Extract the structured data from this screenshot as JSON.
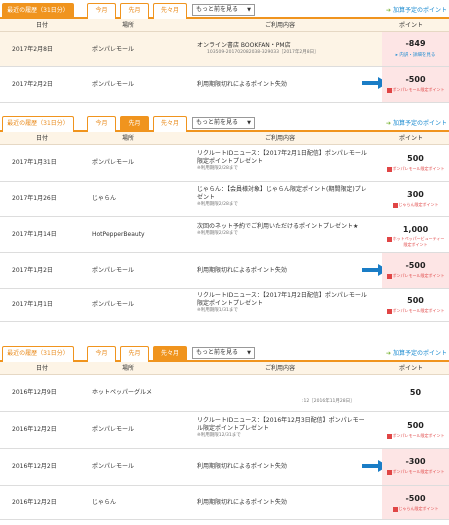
{
  "tabs": {
    "recent": "最近の履歴（31日分）",
    "this_month": "今月",
    "last_month": "先月",
    "two_months_ago": "先々月"
  },
  "select_value": "もっと前を見る",
  "pending_link": "加算予定のポイント",
  "headers": {
    "date": "日付",
    "place": "場所",
    "usage": "ご利用内容",
    "points": "ポイント"
  },
  "colors": {
    "accent": "#f0941e",
    "link": "#1a8ad0",
    "negative_bg": "#fde5e5",
    "arrow": "#1a7dc6"
  },
  "panel1": {
    "rows": [
      {
        "date": "2017年2月8日",
        "place": "ポンパレモール",
        "usage": "オンライン書店 BOOKFAN・PM店",
        "sub": "103509-201702082038-329033［2017年2月8日］",
        "points": "-849",
        "link": "内訳・詳細を見る"
      },
      {
        "date": "2017年2月2日",
        "place": "ポンパレモール",
        "usage": "利用期限切れによるポイント失効",
        "points": "-500",
        "plabel": "ポンパレモール限定ポイント"
      }
    ]
  },
  "panel2": {
    "rows": [
      {
        "date": "2017年1月31日",
        "place": "ポンパレモール",
        "usage": "リクルートIDニュース：【2017年2月1日配信】ポンパレモール限定ポイントプレゼント",
        "sub": "※利用期限2/28まで",
        "points": "500",
        "plabel": "ポンパレモール限定ポイント"
      },
      {
        "date": "2017年1月26日",
        "place": "じゃらん",
        "usage": "じゃらん：【会員様対象】じゃらん限定ポイント(期間限定)プレゼント",
        "sub": "※利用期限2/28まで",
        "points": "300",
        "plabel": "じゃらん限定ポイント"
      },
      {
        "date": "2017年1月14日",
        "place": "HotPepperBeauty",
        "usage": "次回のネット予約でご利用いただけるポイントプレゼント★",
        "sub": "※利用期限2/28まで",
        "points": "1,000",
        "plabel": "ホットペッパービューティー限定ポイント"
      },
      {
        "date": "2017年1月2日",
        "place": "ポンパレモール",
        "usage": "利用期限切れによるポイント失効",
        "points": "-500",
        "plabel": "ポンパレモール限定ポイント"
      },
      {
        "date": "2017年1月1日",
        "place": "ポンパレモール",
        "usage": "リクルートIDニュース：【2017年1月2日配信】ポンパレモール限定ポイントプレゼント",
        "sub": "※利用期限1/31まで",
        "points": "500",
        "plabel": "ポンパレモール限定ポイント"
      }
    ]
  },
  "panel3": {
    "rows": [
      {
        "date": "2016年12月9日",
        "place": "ホットペッパーグルメ",
        "usage": "",
        "sub": ":12［2016年11月28日］",
        "points": "50"
      },
      {
        "date": "2016年12月2日",
        "place": "ポンパレモール",
        "usage": "リクルートIDニュース：【2016年12月3日配信】ポンパレモール限定ポイントプレゼント",
        "sub": "※利用期限12/31まで",
        "points": "500",
        "plabel": "ポンパレモール限定ポイント"
      },
      {
        "date": "2016年12月2日",
        "place": "ポンパレモール",
        "usage": "利用期限切れによるポイント失効",
        "points": "-300",
        "plabel": "ポンパレモール限定ポイント"
      },
      {
        "date": "2016年12月2日",
        "place": "じゃらん",
        "usage": "利用期限切れによるポイント失効",
        "points": "-500",
        "plabel": "じゃらん限定ポイント"
      }
    ]
  }
}
